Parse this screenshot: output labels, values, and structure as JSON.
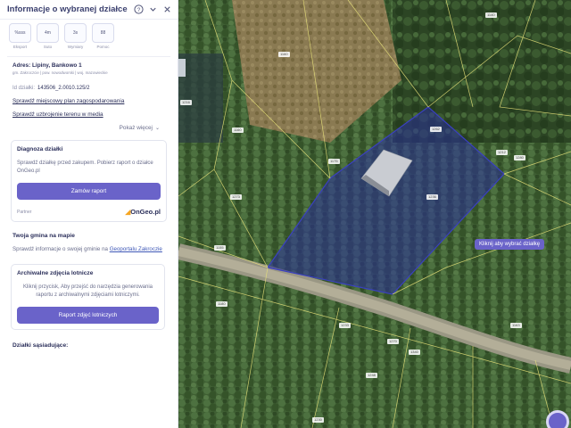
{
  "panel": {
    "title": "Informacje o wybranej działce",
    "actions": [
      {
        "name": "udostepnij",
        "icon": "%sss",
        "label": "Eksport"
      },
      {
        "name": "pomiar",
        "icon": "4m",
        "label": "Suto"
      },
      {
        "name": "wymiary",
        "icon": "3s",
        "label": "Wymiary"
      },
      {
        "name": "pomoc",
        "icon": "88",
        "label": "Pomoc"
      }
    ],
    "address": {
      "main": "Adres: Lipiny, Bankowo 1",
      "sub": "gm. Zakroczcie | pow. nowodworski | woj. mazowieckie"
    },
    "parcel_id_label": "Id działki:",
    "parcel_id_value": "143506_2.0010.125/2",
    "links": [
      "Sprawdź miejscowy plan zagospodarowania",
      "Sprawdź uzbrojenie terenu w media"
    ],
    "more_label": "Pokaż więcej"
  },
  "diagnosis": {
    "title": "Diagnoza działki",
    "text": "Sprawdź działkę przed zakupem. Pobierz raport o działce OnGeo.pl",
    "button": "Zamów raport",
    "partner_label": "Partner",
    "partner_logo": "OnGeo.pl"
  },
  "gmina": {
    "title": "Twoja gmina na mapie",
    "text_before": "Sprawdź informacje o swojej gminie na",
    "link": "Geoportalu Zakroczie"
  },
  "archive": {
    "title": "Archiwalne zdjęcia lotnicze",
    "text": "Kliknij przycisk, Aby przejść do narzędzia generowania raportu z archiwalnymi zdjęciami lotniczymi.",
    "button": "Raport zdjęć lotniczych"
  },
  "adjacent_title": "Działki sąsiadujące:",
  "map": {
    "tooltip": "Kliknij aby wybrać działkę",
    "parcel_labels": [
      "1160",
      "1216",
      "1160",
      "1175",
      "1262",
      "1140",
      "1212",
      "1280",
      "1273",
      "1236",
      "1155",
      "1180",
      "1233",
      "1270",
      "1340",
      "1163",
      "1248",
      "1230"
    ],
    "colors": {
      "selection_fill": "#2a2f9a",
      "parcel_lines": "#e8e27a",
      "accent": "#6a63c9"
    }
  }
}
